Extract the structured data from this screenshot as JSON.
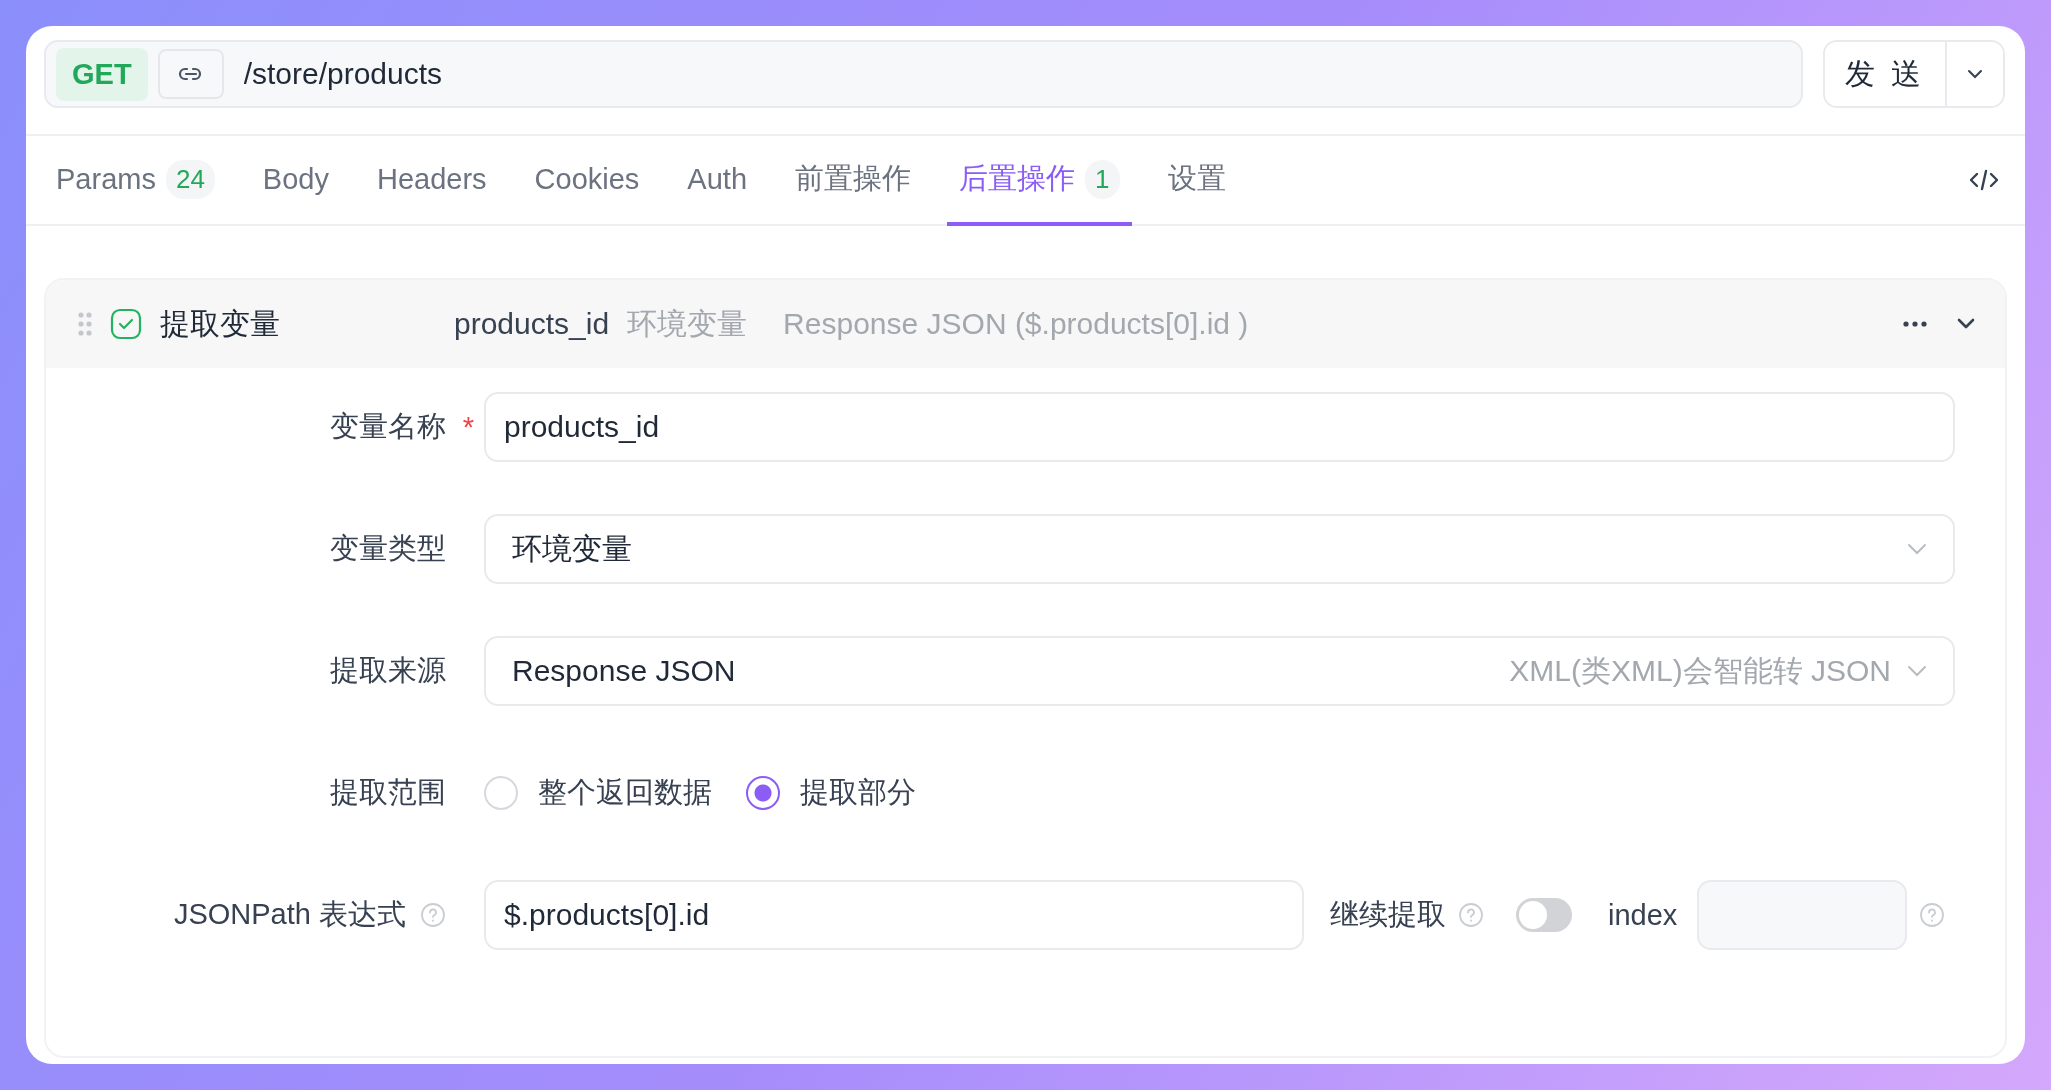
{
  "request": {
    "method": "GET",
    "url": "/store/products",
    "send_label": "发 送"
  },
  "tabs": [
    {
      "label": "Params",
      "badge": "24",
      "selected": false
    },
    {
      "label": "Body",
      "selected": false
    },
    {
      "label": "Headers",
      "selected": false
    },
    {
      "label": "Cookies",
      "selected": false
    },
    {
      "label": "Auth",
      "selected": false
    },
    {
      "label": "前置操作",
      "selected": false
    },
    {
      "label": "后置操作",
      "badge": "1",
      "selected": true
    },
    {
      "label": "设置",
      "selected": false
    }
  ],
  "operation": {
    "enabled": true,
    "title": "提取变量",
    "summary_name": "products_id",
    "summary_type": "环境变量",
    "summary_source": "Response JSON ($.products[0].id )",
    "expanded": true,
    "fields": [
      {
        "kind": "input",
        "label": "变量名称",
        "required_mark": "*",
        "value": "products_id"
      },
      {
        "kind": "select",
        "label": "变量类型",
        "value": "环境变量"
      },
      {
        "kind": "select",
        "label": "提取来源",
        "value": "Response JSON",
        "hint": "XML(类XML)会智能转 JSON"
      },
      {
        "kind": "radio",
        "label": "提取范围",
        "options": [
          {
            "label": "整个返回数据",
            "selected": false
          },
          {
            "label": "提取部分",
            "selected": true
          }
        ]
      },
      {
        "kind": "jsonpath",
        "label": "JSONPath 表达式",
        "value": "$.products[0].id",
        "continue_label": "继续提取",
        "continue_on": false,
        "index_label": "index"
      }
    ]
  }
}
